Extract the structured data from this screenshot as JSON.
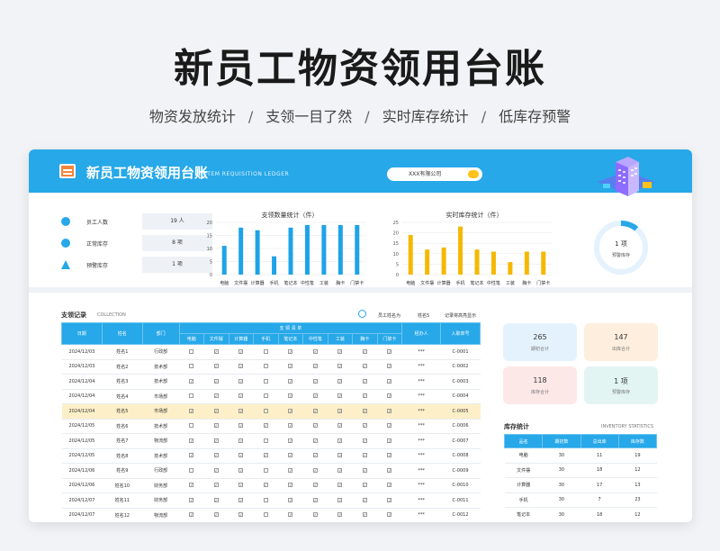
{
  "headline": "新员工物资领用台账",
  "subline": [
    "物资发放统计",
    "支领一目了然",
    "实时库存统计",
    "低库存预警"
  ],
  "subline_sep": "/",
  "app": {
    "title": "新员工物资领用台账",
    "subtitle": "ITEM REQUISITION LEDGER",
    "company": "XXX有限公司"
  },
  "kpis": [
    {
      "label": "员工人数",
      "value": "19 人",
      "icon": "people-icon"
    },
    {
      "label": "正常库存",
      "value": "8 项",
      "icon": "circle-icon"
    },
    {
      "label": "预警库存",
      "value": "1 项",
      "icon": "warning-icon"
    }
  ],
  "chart_data": [
    {
      "type": "bar",
      "title": "支领数量统计（件）",
      "categories": [
        "电脑",
        "文件摆",
        "计算器",
        "手机",
        "笔记本",
        "中性笔",
        "工装",
        "胸卡",
        "门禁卡"
      ],
      "values": [
        11,
        18,
        17,
        7,
        18,
        19,
        19,
        19,
        19
      ],
      "ylim": [
        0,
        20
      ],
      "yticks": [
        0,
        5,
        10,
        15,
        20
      ],
      "color": "#1fa3e8"
    },
    {
      "type": "bar",
      "title": "实时库存统计（件）",
      "categories": [
        "电脑",
        "文件摆",
        "计算器",
        "手机",
        "笔记本",
        "中性笔",
        "工装",
        "胸卡",
        "门禁卡"
      ],
      "values": [
        19,
        12,
        13,
        23,
        12,
        11,
        6,
        11,
        11
      ],
      "ylim": [
        0,
        25
      ],
      "yticks": [
        0,
        5,
        10,
        15,
        20,
        25
      ],
      "color": "#f5b800"
    }
  ],
  "ring": {
    "value": "1 项",
    "label": "预警库存",
    "fraction": 0.11
  },
  "records": {
    "title": "支领记录",
    "subtitle": "COLLECTION",
    "search_label": "员工姓名为",
    "search_value": "姓名5",
    "search_hint": "记录将高亮显示",
    "headers": {
      "date": "日期",
      "name": "姓名",
      "dept": "部门",
      "group": "支 领 清 单",
      "handler": "经办人",
      "id": "入职单号"
    },
    "items": [
      "电脑",
      "文件摆",
      "计算器",
      "手机",
      "笔记本",
      "中性笔",
      "工装",
      "胸卡",
      "门禁卡"
    ],
    "rows": [
      {
        "date": "2024/12/03",
        "name": "姓名1",
        "dept": "行政部",
        "checks": [
          0,
          1,
          1,
          0,
          1,
          1,
          1,
          1,
          1
        ],
        "handler": "***",
        "id": "C-0001"
      },
      {
        "date": "2024/12/03",
        "name": "姓名2",
        "dept": "技术部",
        "checks": [
          0,
          1,
          1,
          0,
          1,
          1,
          1,
          1,
          1
        ],
        "handler": "***",
        "id": "C-0002"
      },
      {
        "date": "2024/12/04",
        "name": "姓名3",
        "dept": "技术部",
        "checks": [
          1,
          1,
          1,
          0,
          1,
          1,
          1,
          1,
          1
        ],
        "handler": "***",
        "id": "C-0003"
      },
      {
        "date": "2024/12/04",
        "name": "姓名4",
        "dept": "市场部",
        "checks": [
          0,
          1,
          1,
          0,
          1,
          1,
          1,
          1,
          1
        ],
        "handler": "***",
        "id": "C-0004"
      },
      {
        "date": "2024/12/04",
        "name": "姓名5",
        "dept": "市场部",
        "checks": [
          1,
          1,
          1,
          0,
          1,
          1,
          1,
          1,
          1
        ],
        "handler": "***",
        "id": "C-0005",
        "highlight": true
      },
      {
        "date": "2024/12/05",
        "name": "姓名6",
        "dept": "技术部",
        "checks": [
          0,
          1,
          1,
          1,
          1,
          1,
          1,
          1,
          1
        ],
        "handler": "***",
        "id": "C-0006"
      },
      {
        "date": "2024/12/05",
        "name": "姓名7",
        "dept": "物流部",
        "checks": [
          1,
          1,
          1,
          0,
          1,
          1,
          1,
          1,
          1
        ],
        "handler": "***",
        "id": "C-0007"
      },
      {
        "date": "2024/12/05",
        "name": "姓名8",
        "dept": "技术部",
        "checks": [
          1,
          1,
          1,
          1,
          1,
          1,
          1,
          1,
          1
        ],
        "handler": "***",
        "id": "C-0008"
      },
      {
        "date": "2024/12/06",
        "name": "姓名9",
        "dept": "行政部",
        "checks": [
          0,
          1,
          1,
          0,
          1,
          1,
          1,
          1,
          1
        ],
        "handler": "***",
        "id": "C-0009"
      },
      {
        "date": "2024/12/06",
        "name": "姓名10",
        "dept": "财务部",
        "checks": [
          1,
          1,
          1,
          1,
          1,
          1,
          1,
          1,
          1
        ],
        "handler": "***",
        "id": "C-0010"
      },
      {
        "date": "2024/12/07",
        "name": "姓名11",
        "dept": "财务部",
        "checks": [
          1,
          1,
          1,
          0,
          1,
          1,
          1,
          1,
          1
        ],
        "handler": "***",
        "id": "C-0011"
      },
      {
        "date": "2024/12/07",
        "name": "姓名12",
        "dept": "物流部",
        "checks": [
          1,
          1,
          1,
          0,
          1,
          1,
          1,
          1,
          1
        ],
        "handler": "***",
        "id": "C-0012"
      }
    ]
  },
  "cards": [
    {
      "value": "265",
      "label": "期初合计",
      "color": "#e4f2fd"
    },
    {
      "value": "147",
      "label": "出库合计",
      "color": "#fdeede"
    },
    {
      "value": "118",
      "label": "库存合计",
      "color": "#fde8e8"
    },
    {
      "value": "1 项",
      "label": "预警库存",
      "color": "#e3f5f3"
    }
  ],
  "stock": {
    "title": "库存统计",
    "subtitle": "INVENTORY STATISTICS",
    "headers": [
      "品名",
      "期初数",
      "总出库",
      "库存数"
    ],
    "rows": [
      [
        "电脑",
        "30",
        "11",
        "19"
      ],
      [
        "文件摆",
        "30",
        "18",
        "12"
      ],
      [
        "计算器",
        "30",
        "17",
        "13"
      ],
      [
        "手机",
        "30",
        "7",
        "23"
      ],
      [
        "笔记本",
        "30",
        "18",
        "12"
      ]
    ]
  }
}
